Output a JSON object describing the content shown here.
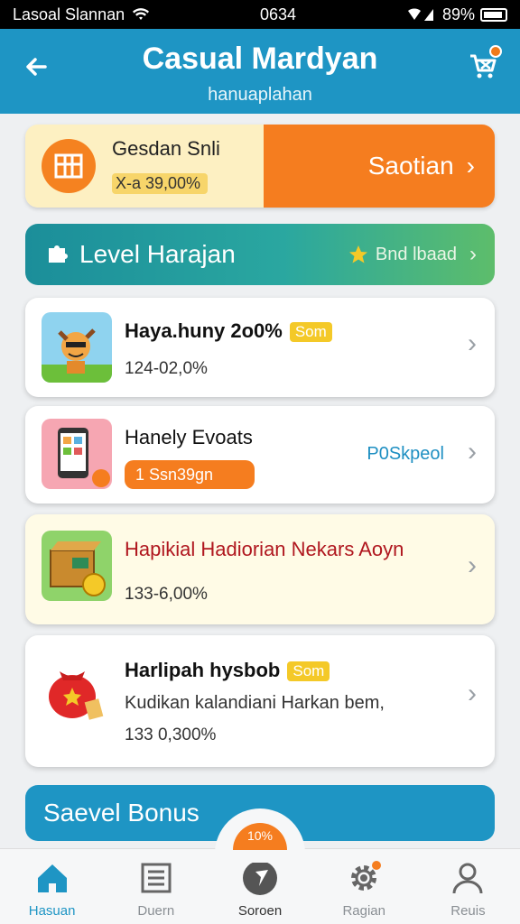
{
  "status_bar": {
    "carrier": "Lasoal Slannan",
    "time": "0634",
    "battery": "89%"
  },
  "app_bar": {
    "title": "Casual Mardyan",
    "subtitle": "hanuaplahan",
    "back_icon": "arrow-left-icon",
    "cart_icon": "cart-icon"
  },
  "promo": {
    "name": "Gesdan Snli",
    "value": "X-a 39,00%",
    "action": "Saotian"
  },
  "level": {
    "title": "Level Harajan",
    "action": "Bnd lbaad"
  },
  "items": [
    {
      "title": "Haya.huny 2o0%",
      "badge": "Som",
      "value": "124-02,0%"
    },
    {
      "title": "Hanely Evoats",
      "pill": "1 Ssn39gn",
      "link": "P0Skpeol"
    },
    {
      "title": "Hapikial Hadiorian Nekars Aoyn",
      "value": "133-6,00%"
    },
    {
      "title": "Harlipah hysbob",
      "badge": "Som",
      "description": "Kudikan kalandiani Harkan bem,",
      "value": "133 0,300%"
    }
  ],
  "bonus": {
    "title": "Saevel Bonus",
    "fab_text": "10%"
  },
  "tabs": [
    {
      "label": "Hasuan",
      "icon": "home-icon",
      "active": true
    },
    {
      "label": "Duern",
      "icon": "list-icon"
    },
    {
      "label": "Soroen",
      "icon": "compass-icon"
    },
    {
      "label": "Ragian",
      "icon": "gear-icon"
    },
    {
      "label": "Reuis",
      "icon": "user-icon"
    }
  ],
  "colors": {
    "primary": "#1e95c4",
    "accent": "#f57d1f",
    "badge": "#f4c928"
  }
}
